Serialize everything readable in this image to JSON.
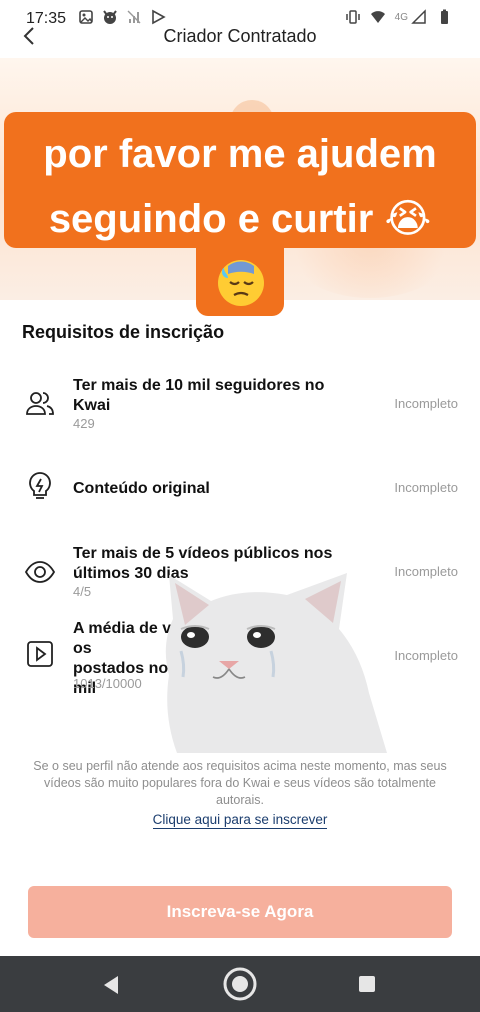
{
  "status_bar": {
    "time": "17:35",
    "network": "4G",
    "icons_left": [
      "image-icon",
      "devil-icon",
      "signal-off-icon",
      "play-store-icon"
    ],
    "icons_right": [
      "vibrate-icon",
      "wifi-icon",
      "signal-icon",
      "battery-icon"
    ]
  },
  "header": {
    "title": "Criador Contratado",
    "back_icon": "chevron-left-icon"
  },
  "banner": {
    "overlay_line1": "por favor me ajudem",
    "overlay_line2": "seguindo e curtir",
    "emoji_cry": "😭",
    "emoji_sad": "sad-sweat-face"
  },
  "requirements": {
    "title": "Requisitos de inscrição",
    "items": [
      {
        "icon": "users-icon",
        "text": "Ter mais de 10 mil seguidores no Kwai",
        "sub": "429",
        "status": "Incompleto"
      },
      {
        "icon": "lightbulb-icon",
        "text": "Conteúdo original",
        "sub": "",
        "status": "Incompleto"
      },
      {
        "icon": "eye-icon",
        "text": "Ter mais de 5 vídeos públicos nos últimos 30 dias",
        "sub": "4/5",
        "status": "Incompleto"
      },
      {
        "icon": "play-icon",
        "text": "A média de v… …os postados no… … mil",
        "text_line1": "A média de v",
        "text_line1_tail": "os",
        "text_line2": "postados no",
        "text_line3": "mil",
        "sub": "1013/10000",
        "status": "Incompleto"
      }
    ]
  },
  "note": "Se o seu perfil não atende aos requisitos acima neste momento, mas seus vídeos são muito populares fora do Kwai e seus vídeos são totalmente autorais.",
  "link": "Clique aqui para se inscrever",
  "cta": "Inscreva-se Agora",
  "colors": {
    "overlay": "#f1711d",
    "cta": "#f6b09d",
    "link": "#1b3d6e",
    "navbar": "#3a3d40"
  }
}
